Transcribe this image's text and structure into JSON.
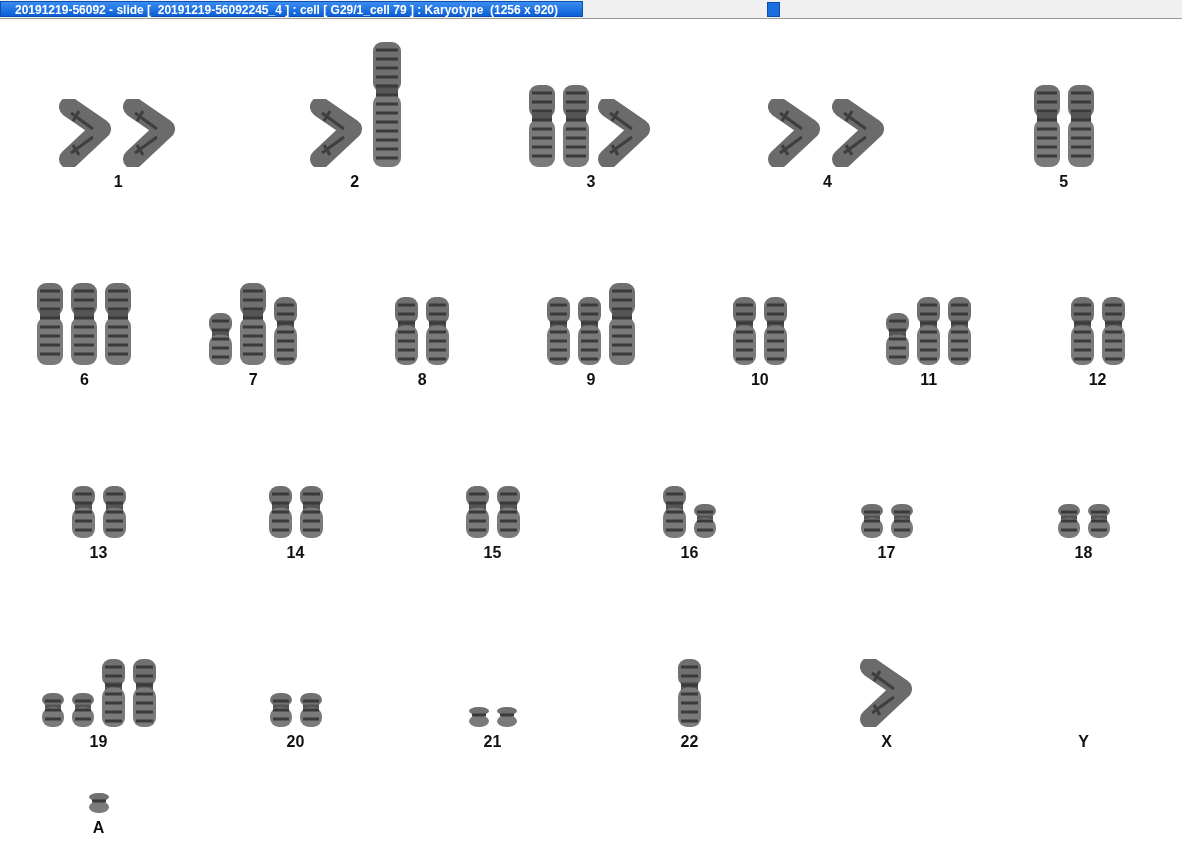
{
  "window": {
    "title": "20191219-56092 - slide [  20191219-56092245_4 ] : cell [ G29/1_cell 79 ] : Karyotype  (1256 x 920)"
  },
  "karyotype": {
    "rows": [
      [
        {
          "label": "1",
          "chromosomes": [
            {
              "kind": "bent"
            },
            {
              "kind": "bent"
            }
          ]
        },
        {
          "label": "2",
          "chromosomes": [
            {
              "kind": "bent"
            },
            {
              "kind": "extra-long"
            }
          ]
        },
        {
          "label": "3",
          "chromosomes": [
            {
              "kind": "long"
            },
            {
              "kind": "long"
            },
            {
              "kind": "bent"
            }
          ]
        },
        {
          "label": "4",
          "chromosomes": [
            {
              "kind": "bent"
            },
            {
              "kind": "bent"
            }
          ]
        },
        {
          "label": "5",
          "chromosomes": [
            {
              "kind": "long"
            },
            {
              "kind": "long"
            }
          ]
        }
      ],
      [
        {
          "label": "6",
          "chromosomes": [
            {
              "kind": "long"
            },
            {
              "kind": "long"
            },
            {
              "kind": "long"
            }
          ]
        },
        {
          "label": "7",
          "chromosomes": [
            {
              "kind": "short"
            },
            {
              "kind": "long"
            },
            {
              "kind": "medium"
            }
          ]
        },
        {
          "label": "8",
          "chromosomes": [
            {
              "kind": "medium"
            },
            {
              "kind": "medium"
            }
          ]
        },
        {
          "label": "9",
          "chromosomes": [
            {
              "kind": "medium"
            },
            {
              "kind": "medium"
            },
            {
              "kind": "long"
            }
          ]
        },
        {
          "label": "10",
          "chromosomes": [
            {
              "kind": "medium"
            },
            {
              "kind": "medium"
            }
          ]
        },
        {
          "label": "11",
          "chromosomes": [
            {
              "kind": "short"
            },
            {
              "kind": "medium"
            },
            {
              "kind": "medium"
            }
          ]
        },
        {
          "label": "12",
          "chromosomes": [
            {
              "kind": "medium"
            },
            {
              "kind": "medium"
            }
          ]
        }
      ],
      [
        {
          "label": "13",
          "chromosomes": [
            {
              "kind": "short"
            },
            {
              "kind": "short"
            }
          ]
        },
        {
          "label": "14",
          "chromosomes": [
            {
              "kind": "short"
            },
            {
              "kind": "short"
            }
          ]
        },
        {
          "label": "15",
          "chromosomes": [
            {
              "kind": "short"
            },
            {
              "kind": "short"
            }
          ]
        },
        {
          "label": "16",
          "chromosomes": [
            {
              "kind": "short"
            },
            {
              "kind": "small"
            }
          ]
        },
        {
          "label": "17",
          "chromosomes": [
            {
              "kind": "small"
            },
            {
              "kind": "small"
            }
          ]
        },
        {
          "label": "18",
          "chromosomes": [
            {
              "kind": "small"
            },
            {
              "kind": "small"
            }
          ]
        }
      ],
      [
        {
          "label": "19",
          "chromosomes": [
            {
              "kind": "small"
            },
            {
              "kind": "small"
            },
            {
              "kind": "medium"
            },
            {
              "kind": "medium"
            }
          ]
        },
        {
          "label": "20",
          "chromosomes": [
            {
              "kind": "small"
            },
            {
              "kind": "small"
            }
          ]
        },
        {
          "label": "21",
          "chromosomes": [
            {
              "kind": "tiny"
            },
            {
              "kind": "tiny"
            }
          ]
        },
        {
          "label": "22",
          "chromosomes": [
            {
              "kind": "medium"
            }
          ]
        },
        {
          "label": "X",
          "chromosomes": [
            {
              "kind": "bent"
            }
          ]
        },
        {
          "label": "Y"
        }
      ],
      [
        {
          "label": "A",
          "chromosomes": [
            {
              "kind": "tiny"
            }
          ]
        }
      ]
    ]
  }
}
